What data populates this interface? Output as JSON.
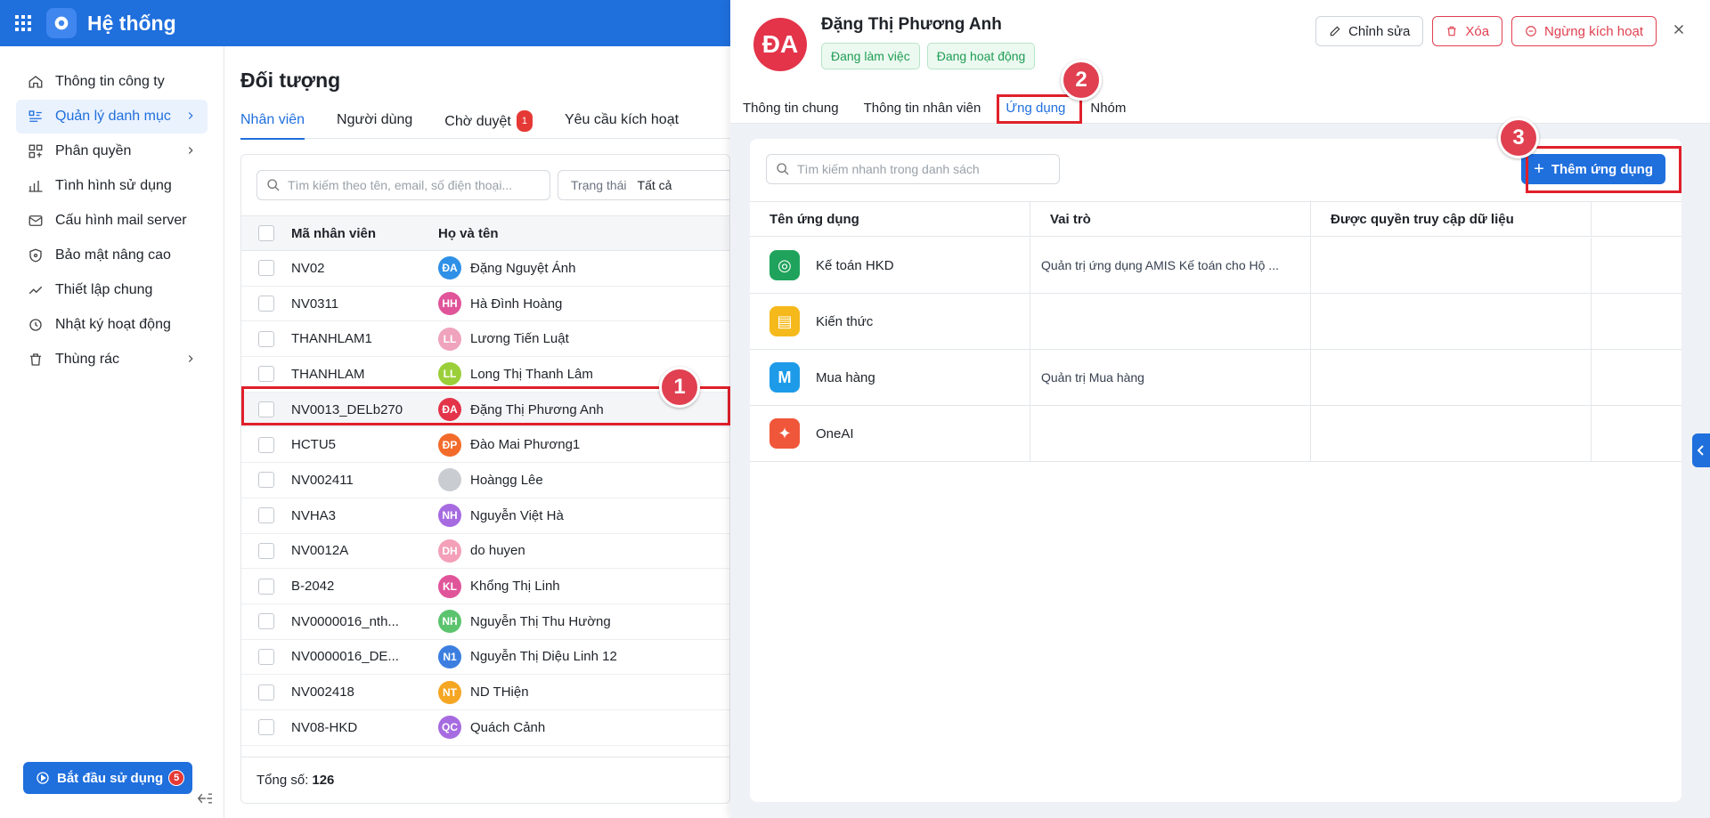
{
  "topbar": {
    "title": "Hệ thống"
  },
  "sidebar": {
    "items": [
      {
        "label": "Thông tin công ty",
        "icon": "home-icon"
      },
      {
        "label": "Quản lý danh mục",
        "icon": "catalog-icon"
      },
      {
        "label": "Phân quyền",
        "icon": "permission-icon"
      },
      {
        "label": "Tình hình sử dụng",
        "icon": "bar-chart-icon"
      },
      {
        "label": "Cấu hình mail server",
        "icon": "mail-icon"
      },
      {
        "label": "Bảo mật nâng cao",
        "icon": "shield-icon"
      },
      {
        "label": "Thiết lập chung",
        "icon": "trend-icon"
      },
      {
        "label": "Nhật ký hoạt động",
        "icon": "history-icon"
      },
      {
        "label": "Thùng rác",
        "icon": "trash-icon"
      }
    ],
    "start_label": "Bắt đầu sử dụng",
    "start_badge": "5"
  },
  "main": {
    "title": "Đối tượng",
    "tabs": [
      {
        "label": "Nhân viên"
      },
      {
        "label": "Người dùng"
      },
      {
        "label": "Chờ duyệt",
        "count": "1"
      },
      {
        "label": "Yêu cầu kích hoạt"
      }
    ],
    "search_placeholder": "Tìm kiếm theo tên, email, số điện thoại...",
    "status_label": "Trạng thái",
    "status_value": "Tất cả",
    "columns": {
      "code": "Mã nhân viên",
      "name": "Họ và tên"
    },
    "rows": [
      {
        "code": "NV02",
        "initials": "ĐA",
        "name": "Đặng Nguyệt Ánh",
        "color": "#2e90e6"
      },
      {
        "code": "NV0311",
        "initials": "HH",
        "name": "Hà Đình Hoàng",
        "color": "#e0559a"
      },
      {
        "code": "THANHLAM1",
        "initials": "LL",
        "name": "Lương Tiến Luật",
        "color": "#f0a3bd"
      },
      {
        "code": "THANHLAM",
        "initials": "LL",
        "name": "Long Thị Thanh Lâm",
        "color": "#9bcf3a"
      },
      {
        "code": "NV0013_DELb270",
        "initials": "ĐA",
        "name": "Đặng Thị Phương Anh",
        "color": "#e3344a"
      },
      {
        "code": "HCTU5",
        "initials": "ĐP",
        "name": "Đào Mai Phương1",
        "color": "#f26b2a"
      },
      {
        "code": "NV002411",
        "initials": "",
        "name": "Hoàngg Lêe",
        "color": "#c9ccd1"
      },
      {
        "code": "NVHA3",
        "initials": "NH",
        "name": "Nguyễn Việt Hà",
        "color": "#a66be0"
      },
      {
        "code": "NV0012A",
        "initials": "DH",
        "name": "do huyen",
        "color": "#f3a0b8"
      },
      {
        "code": "B-2042",
        "initials": "KL",
        "name": "Khổng Thị Linh",
        "color": "#e0559a"
      },
      {
        "code": "NV0000016_nth...",
        "initials": "NH",
        "name": "Nguyễn Thị Thu Hường",
        "color": "#5cc46e"
      },
      {
        "code": "NV0000016_DE...",
        "initials": "N1",
        "name": "Nguyễn Thị Diệu Linh 12",
        "color": "#3b7ee0"
      },
      {
        "code": "NV002418",
        "initials": "NT",
        "name": "ND THiện",
        "color": "#f5a623"
      },
      {
        "code": "NV08-HKD",
        "initials": "QC",
        "name": "Quách Cảnh",
        "color": "#a66be0"
      }
    ],
    "total_label": "Tổng số:",
    "total_value": "126"
  },
  "annotations": [
    "1",
    "2",
    "3"
  ],
  "panel": {
    "initials": "ĐA",
    "name": "Đặng Thị Phương Anh",
    "tags": [
      "Đang làm việc",
      "Đang hoạt động"
    ],
    "actions": {
      "edit": "Chỉnh sửa",
      "delete": "Xóa",
      "deactivate": "Ngừng kích hoạt"
    },
    "tabs": [
      "Thông tin chung",
      "Thông tin nhân viên",
      "Ứng dụng",
      "Nhóm"
    ],
    "search_placeholder": "Tìm kiếm nhanh trong danh sách",
    "add_label": "Thêm ứng dụng",
    "columns": [
      "Tên ứng dụng",
      "Vai trò",
      "Được quyền truy cập dữ liệu"
    ],
    "apps": [
      {
        "name": "Kế toán HKD",
        "role": "Quản trị ứng dụng AMIS Kế toán cho Hộ ...",
        "icon": "ketoan-app-icon",
        "color": "#1fa35c"
      },
      {
        "name": "Kiến thức",
        "role": "",
        "icon": "book-app-icon",
        "color": "#f5b91b"
      },
      {
        "name": "Mua hàng",
        "role": "Quản trị Mua hàng",
        "icon": "muahang-app-icon",
        "color": "#1e9be8"
      },
      {
        "name": "OneAI",
        "role": "",
        "icon": "sparkle-app-icon",
        "color": "#f0573a"
      }
    ]
  }
}
